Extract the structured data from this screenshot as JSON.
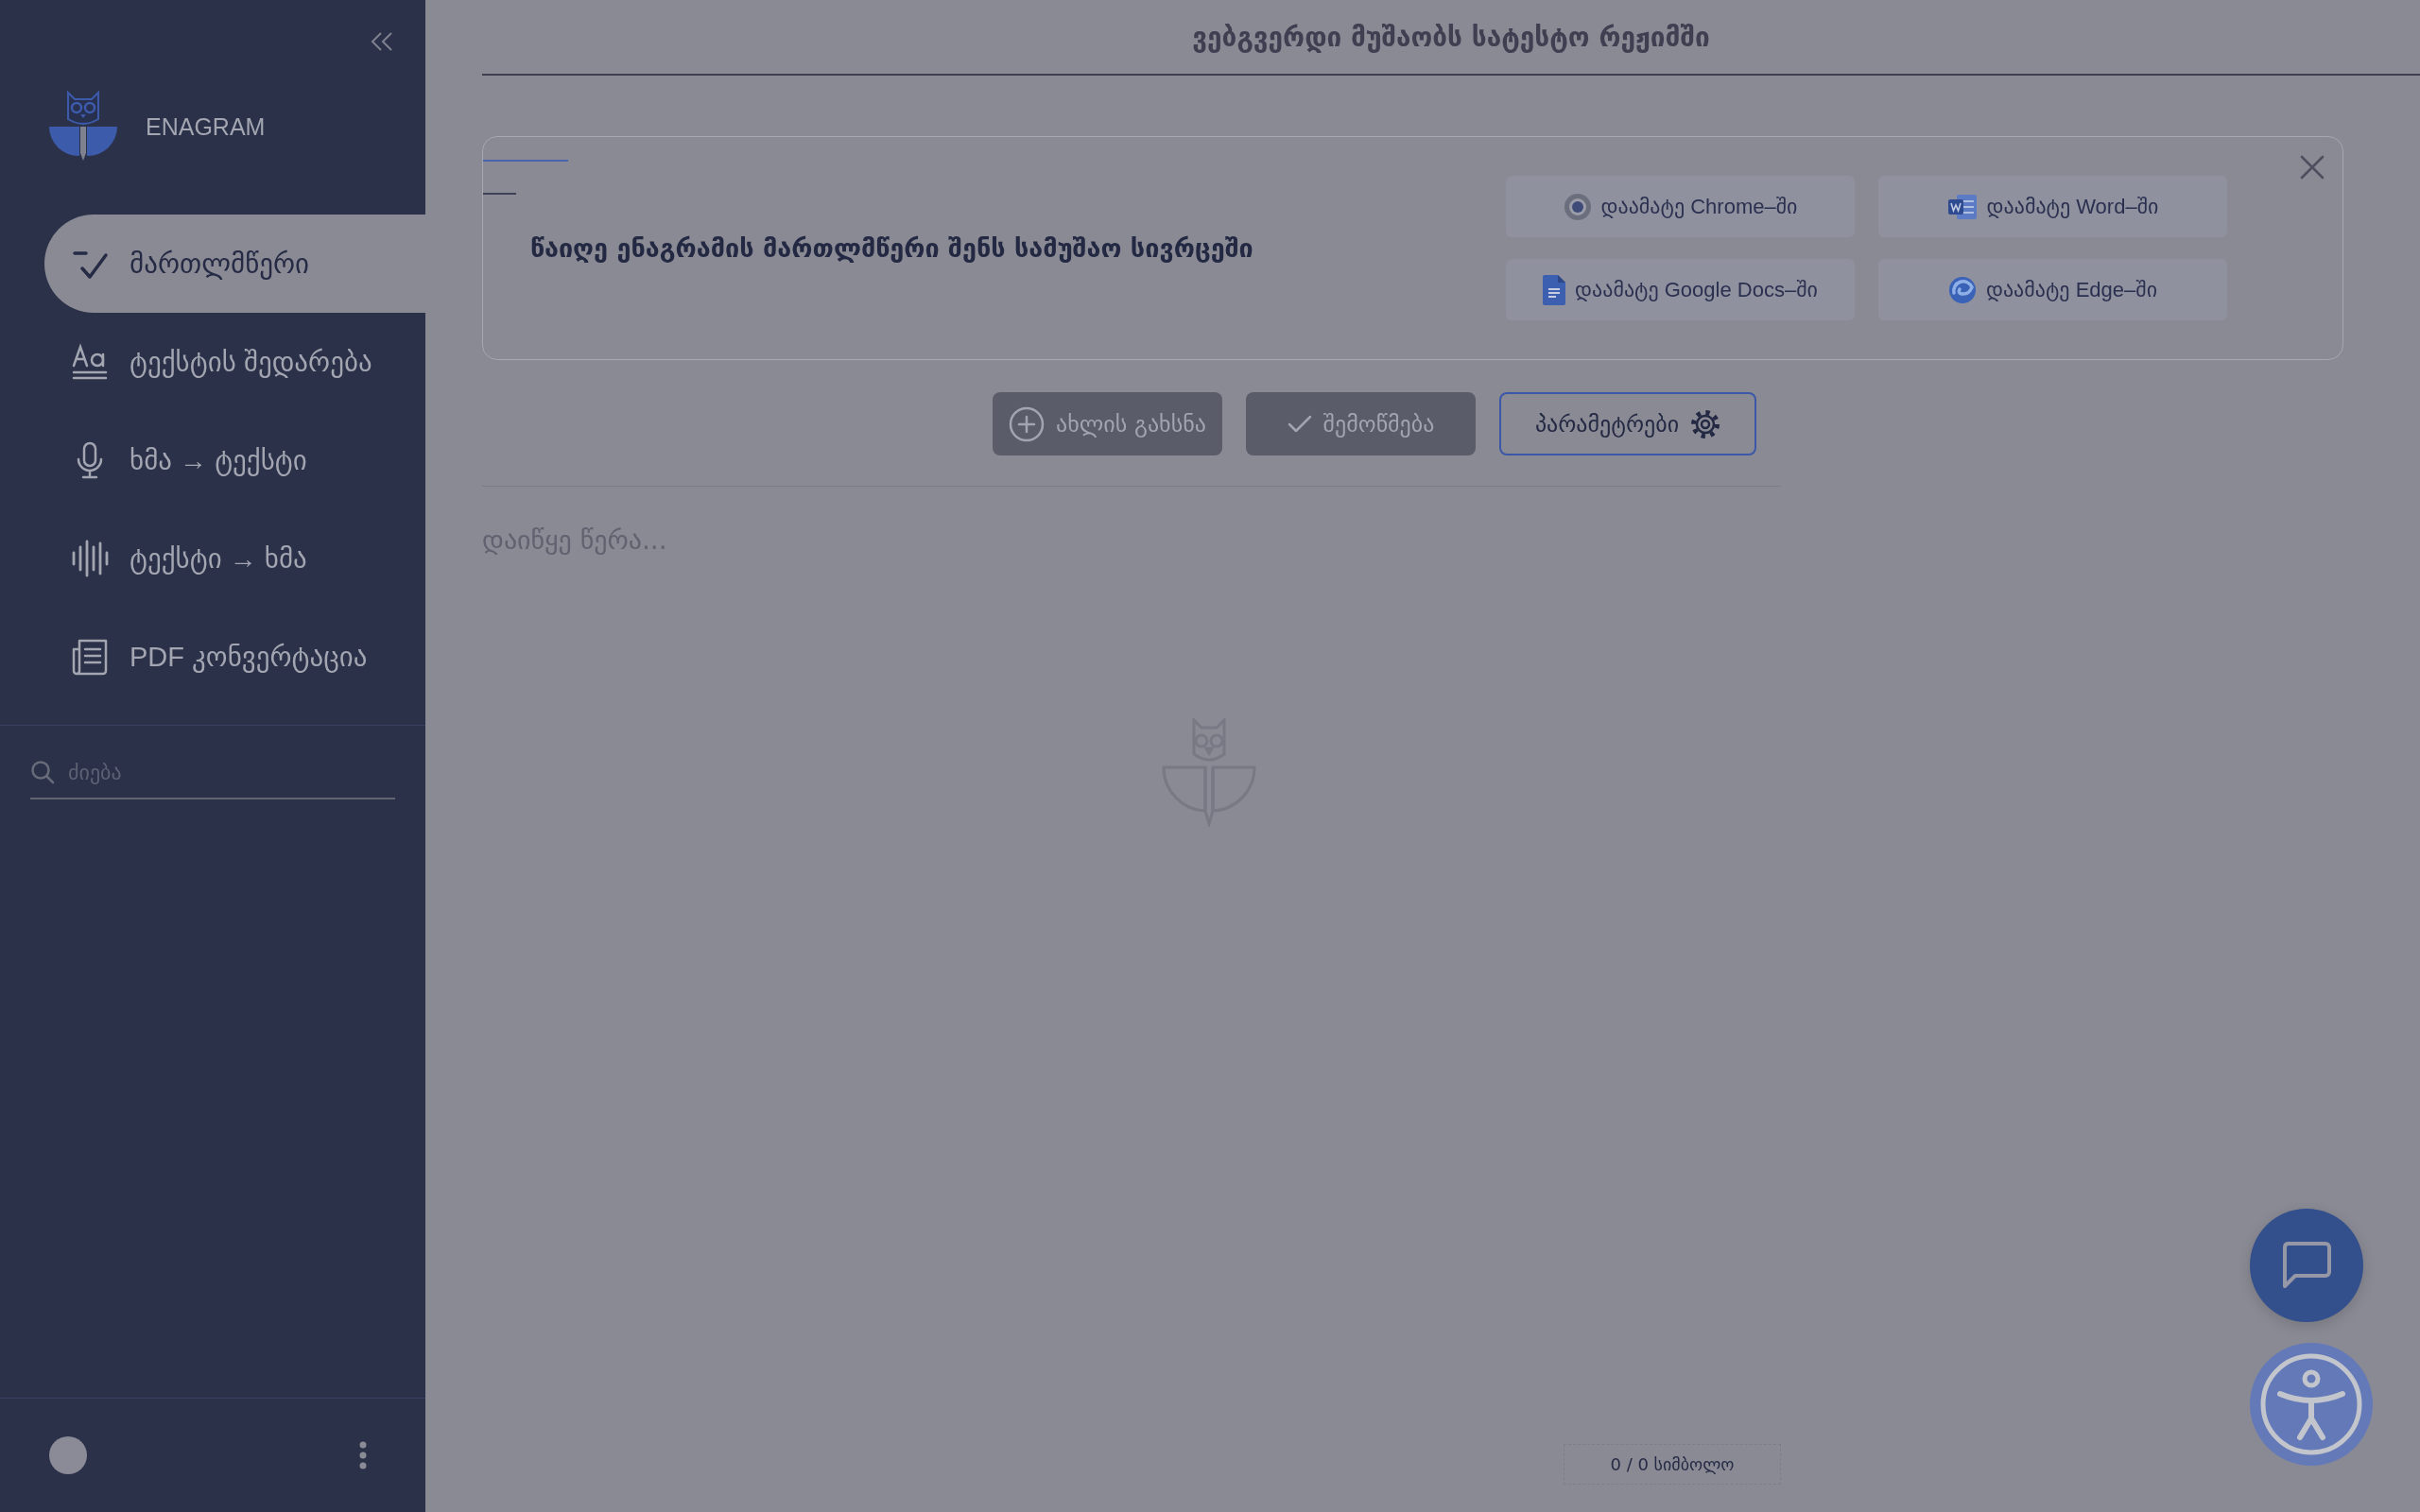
{
  "sidebar": {
    "brand": "ENAGRAM",
    "nav_items": [
      {
        "label": "მართლმწერი",
        "selected": true
      },
      {
        "label": "ტექსტის შედარება",
        "selected": false
      },
      {
        "label": "ხმა → ტექსტი",
        "selected": false
      },
      {
        "label": "ტექსტი → ხმა",
        "selected": false
      },
      {
        "label": "PDF კონვერტაცია",
        "selected": false
      }
    ],
    "search": {
      "placeholder": "ძიება"
    }
  },
  "header": {
    "notice": "ვებგვერდი მუშაობს სატესტო რეჟიმში"
  },
  "promo_banner": {
    "text": "წაიღე ენაგრამის მართლმწერი შენს სამუშაო სივრცეში",
    "buttons": [
      "დაამატე Chrome–ში",
      "დაამატე Word–ში",
      "დაამატე Google Docs–ში",
      "დაამატე Edge–ში"
    ]
  },
  "toolbar": {
    "buttons": [
      {
        "label": "ახლის გახსნა",
        "disabled": true
      },
      {
        "label": "შემოწმება",
        "disabled": true
      },
      {
        "label": "პარამეტრები",
        "disabled": false
      }
    ]
  },
  "editor": {
    "placeholder": "დაიწყე წერა...",
    "counter": "0 / 0 სიმბოლო"
  }
}
